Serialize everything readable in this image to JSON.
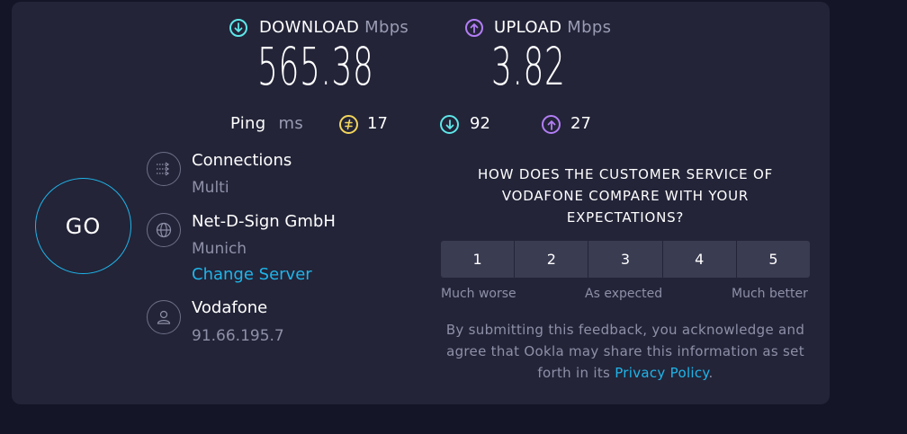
{
  "colors": {
    "background": "#141526",
    "panel": "#232438",
    "download_accent": "#5ee6e8",
    "upload_accent": "#b37ef5",
    "ping_accent": "#f2d45c",
    "link": "#1fb5e9"
  },
  "download": {
    "label": "DOWNLOAD",
    "unit": "Mbps",
    "value": "565.38",
    "icon": "download-arrow-icon"
  },
  "upload": {
    "label": "UPLOAD",
    "unit": "Mbps",
    "value": "3.82",
    "icon": "upload-arrow-icon"
  },
  "ping": {
    "label": "Ping",
    "unit": "ms",
    "idle": "17",
    "download": "92",
    "upload": "27"
  },
  "go_button": {
    "label": "GO"
  },
  "connections": {
    "title": "Connections",
    "value": "Multi",
    "icon": "connections-icon"
  },
  "server": {
    "name": "Net-D-Sign GmbH",
    "location": "Munich",
    "change_link": "Change Server",
    "icon": "globe-icon"
  },
  "provider": {
    "name": "Vodafone",
    "ip": "91.66.195.7",
    "icon": "user-icon"
  },
  "survey": {
    "question_line1": "HOW DOES THE CUSTOMER SERVICE OF",
    "question_line2": "VODAFONE COMPARE WITH YOUR",
    "question_line3": "EXPECTATIONS?",
    "options": [
      "1",
      "2",
      "3",
      "4",
      "5"
    ],
    "scale_low": "Much worse",
    "scale_mid": "As expected",
    "scale_high": "Much better",
    "disclaimer_line1": "By submitting this feedback, you acknowledge and",
    "disclaimer_line2": "agree that Ookla may share this information as set",
    "disclaimer_line3_prefix": "forth in its ",
    "privacy_link": "Privacy Policy",
    "disclaimer_suffix": "."
  }
}
